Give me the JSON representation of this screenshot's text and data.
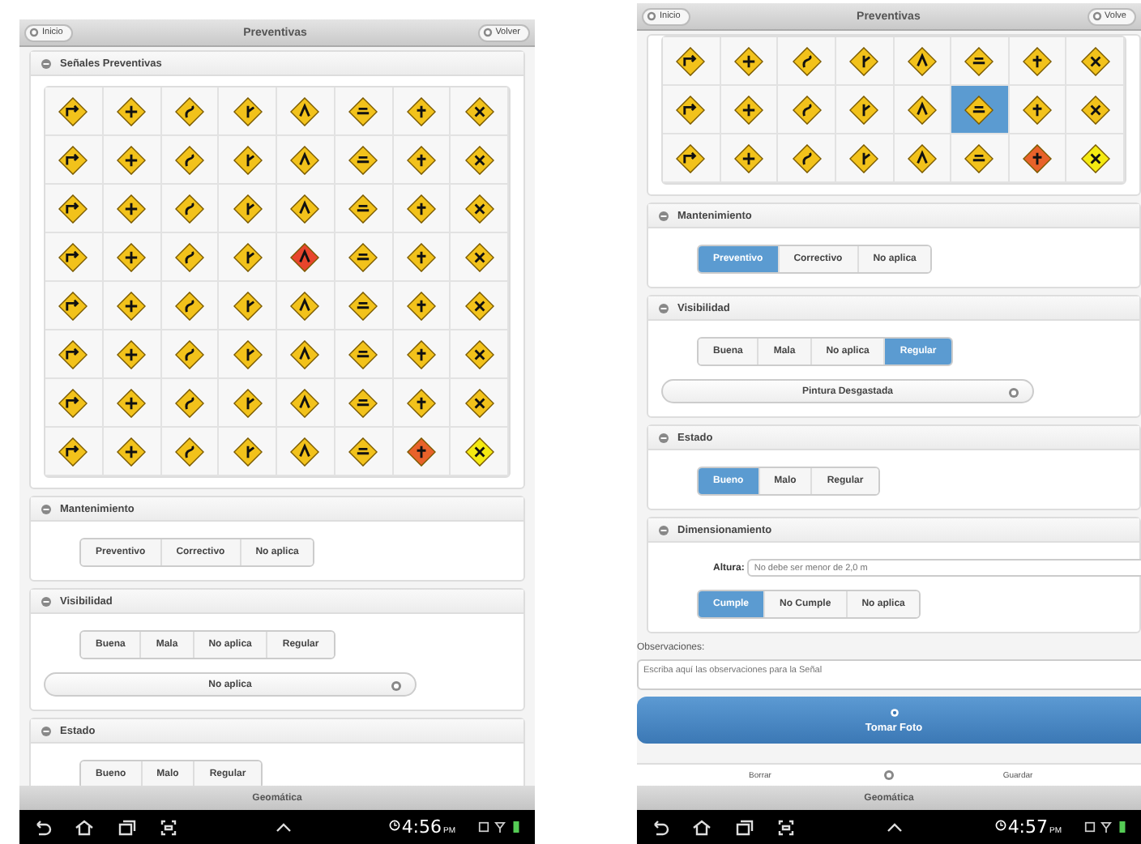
{
  "screens": [
    {
      "header": {
        "left_button": "Inicio",
        "title": "Preventivas",
        "right_button": "Volver"
      },
      "sections": [
        {
          "kind": "signs",
          "title": "Señales Preventivas",
          "rows": [
            [
              {
                "selected": false,
                "color": "#f2c21b"
              },
              {
                "selected": false,
                "color": "#f2c21b"
              },
              {
                "selected": false,
                "color": "#f2c21b"
              },
              {
                "selected": false,
                "color": "#f2c21b"
              },
              {
                "selected": false,
                "color": "#f2c21b"
              },
              {
                "selected": false,
                "color": "#f2c21b"
              },
              {
                "selected": false,
                "color": "#f2c21b"
              },
              {
                "selected": false,
                "color": "#f2c21b"
              }
            ],
            [
              {
                "selected": false,
                "color": "#f2c21b"
              },
              {
                "selected": false,
                "color": "#f2c21b"
              },
              {
                "selected": false,
                "color": "#f2c21b"
              },
              {
                "selected": false,
                "color": "#f2c21b"
              },
              {
                "selected": false,
                "color": "#f2c21b"
              },
              {
                "selected": false,
                "color": "#f2c21b"
              },
              {
                "selected": false,
                "color": "#f2c21b"
              },
              {
                "selected": false,
                "color": "#f2c21b"
              }
            ],
            [
              {
                "selected": false,
                "color": "#f2c21b"
              },
              {
                "selected": false,
                "color": "#f2c21b"
              },
              {
                "selected": false,
                "color": "#f2c21b"
              },
              {
                "selected": false,
                "color": "#f2c21b"
              },
              {
                "selected": false,
                "color": "#f2c21b"
              },
              {
                "selected": false,
                "color": "#f2c21b"
              },
              {
                "selected": false,
                "color": "#f2c21b"
              },
              {
                "selected": false,
                "color": "#f2c21b"
              }
            ],
            [
              {
                "selected": false,
                "color": "#f2c21b"
              },
              {
                "selected": false,
                "color": "#f2c21b"
              },
              {
                "selected": false,
                "color": "#f2c21b"
              },
              {
                "selected": false,
                "color": "#f2c21b"
              },
              {
                "selected": false,
                "color": "#e8452c"
              },
              {
                "selected": false,
                "color": "#f2c21b"
              },
              {
                "selected": false,
                "color": "#f2c21b"
              },
              {
                "selected": false,
                "color": "#f2c21b"
              }
            ],
            [
              {
                "selected": false,
                "color": "#f2c21b"
              },
              {
                "selected": false,
                "color": "#f2c21b"
              },
              {
                "selected": false,
                "color": "#f2c21b"
              },
              {
                "selected": false,
                "color": "#f2c21b"
              },
              {
                "selected": false,
                "color": "#f2c21b"
              },
              {
                "selected": false,
                "color": "#f2c21b"
              },
              {
                "selected": false,
                "color": "#f2c21b"
              },
              {
                "selected": false,
                "color": "#f2c21b"
              }
            ],
            [
              {
                "selected": false,
                "color": "#f2c21b"
              },
              {
                "selected": false,
                "color": "#f2c21b"
              },
              {
                "selected": false,
                "color": "#f2c21b"
              },
              {
                "selected": false,
                "color": "#f2c21b"
              },
              {
                "selected": false,
                "color": "#f2c21b"
              },
              {
                "selected": false,
                "color": "#f2c21b"
              },
              {
                "selected": false,
                "color": "#f2c21b"
              },
              {
                "selected": false,
                "color": "#f2c21b"
              }
            ],
            [
              {
                "selected": false,
                "color": "#f2c21b"
              },
              {
                "selected": false,
                "color": "#f2c21b"
              },
              {
                "selected": false,
                "color": "#f2c21b"
              },
              {
                "selected": false,
                "color": "#f2c21b"
              },
              {
                "selected": false,
                "color": "#f2c21b"
              },
              {
                "selected": false,
                "color": "#f2c21b"
              },
              {
                "selected": false,
                "color": "#f2c21b"
              },
              {
                "selected": false,
                "color": "#f2c21b"
              }
            ],
            [
              {
                "selected": false,
                "color": "#f2c21b"
              },
              {
                "selected": false,
                "color": "#f2c21b"
              },
              {
                "selected": false,
                "color": "#f2c21b"
              },
              {
                "selected": false,
                "color": "#f2c21b"
              },
              {
                "selected": false,
                "color": "#f2c21b"
              },
              {
                "selected": false,
                "color": "#f2c21b"
              },
              {
                "selected": false,
                "color": "#e8622a"
              },
              {
                "selected": false,
                "color": "#f4ea12"
              }
            ]
          ]
        },
        {
          "kind": "segmented",
          "title": "Mantenimiento",
          "options": [
            {
              "label": "Preventivo",
              "selected": false
            },
            {
              "label": "Correctivo",
              "selected": false
            },
            {
              "label": "No aplica",
              "selected": false
            }
          ]
        },
        {
          "kind": "segmented",
          "title": "Visibilidad",
          "options": [
            {
              "label": "Buena",
              "selected": false
            },
            {
              "label": "Mala",
              "selected": false
            },
            {
              "label": "No aplica",
              "selected": false
            },
            {
              "label": "Regular",
              "selected": false
            }
          ],
          "select": "No aplica"
        },
        {
          "kind": "segmented",
          "title": "Estado",
          "options": [
            {
              "label": "Bueno",
              "selected": false
            },
            {
              "label": "Malo",
              "selected": false
            },
            {
              "label": "Regular",
              "selected": false
            }
          ]
        }
      ],
      "footer": "Geomática",
      "time": "4:56",
      "meridiem": "PM"
    },
    {
      "header": {
        "left_button": "Inicio",
        "title": "Preventivas",
        "right_button": "Volve"
      },
      "sections": [
        {
          "kind": "signs",
          "rows": [
            [
              {
                "selected": false,
                "color": "#f2c21b"
              },
              {
                "selected": false,
                "color": "#f2c21b"
              },
              {
                "selected": false,
                "color": "#f2c21b"
              },
              {
                "selected": false,
                "color": "#f2c21b"
              },
              {
                "selected": false,
                "color": "#f2c21b"
              },
              {
                "selected": false,
                "color": "#f2c21b"
              },
              {
                "selected": false,
                "color": "#f2c21b"
              },
              {
                "selected": false,
                "color": "#f2c21b"
              }
            ],
            [
              {
                "selected": false,
                "color": "#f2c21b"
              },
              {
                "selected": false,
                "color": "#f2c21b"
              },
              {
                "selected": false,
                "color": "#f2c21b"
              },
              {
                "selected": false,
                "color": "#f2c21b"
              },
              {
                "selected": false,
                "color": "#f2c21b"
              },
              {
                "selected": true,
                "color": "#f2c21b"
              },
              {
                "selected": false,
                "color": "#f2c21b"
              },
              {
                "selected": false,
                "color": "#f2c21b"
              }
            ],
            [
              {
                "selected": false,
                "color": "#f2c21b"
              },
              {
                "selected": false,
                "color": "#f2c21b"
              },
              {
                "selected": false,
                "color": "#f2c21b"
              },
              {
                "selected": false,
                "color": "#f2c21b"
              },
              {
                "selected": false,
                "color": "#f2c21b"
              },
              {
                "selected": false,
                "color": "#f2c21b"
              },
              {
                "selected": false,
                "color": "#e8622a"
              },
              {
                "selected": false,
                "color": "#f4ea12"
              }
            ]
          ]
        },
        {
          "kind": "segmented",
          "title": "Mantenimiento",
          "options": [
            {
              "label": "Preventivo",
              "selected": true
            },
            {
              "label": "Correctivo",
              "selected": false
            },
            {
              "label": "No aplica",
              "selected": false
            }
          ]
        },
        {
          "kind": "segmented",
          "title": "Visibilidad",
          "options": [
            {
              "label": "Buena",
              "selected": false
            },
            {
              "label": "Mala",
              "selected": false
            },
            {
              "label": "No aplica",
              "selected": false
            },
            {
              "label": "Regular",
              "selected": true
            }
          ],
          "select": "Pintura Desgastada"
        },
        {
          "kind": "segmented",
          "title": "Estado",
          "options": [
            {
              "label": "Bueno",
              "selected": true
            },
            {
              "label": "Malo",
              "selected": false
            },
            {
              "label": "Regular",
              "selected": false
            }
          ]
        },
        {
          "kind": "segmented",
          "title": "Dimensionamiento",
          "field": {
            "label": "Altura:",
            "placeholder": "No debe ser menor de 2,0 m"
          },
          "options": [
            {
              "label": "Cumple",
              "selected": true
            },
            {
              "label": "No Cumple",
              "selected": false
            },
            {
              "label": "No aplica",
              "selected": false
            }
          ]
        }
      ],
      "observations": {
        "label": "Observaciones:",
        "placeholder": "Escriba aquí las observaciones para la Señal"
      },
      "photo_button": "Tomar Foto",
      "toolbar": [
        "Borrar",
        "Guardar"
      ],
      "footer": "Geomática",
      "time": "4:57",
      "meridiem": "PM"
    }
  ]
}
